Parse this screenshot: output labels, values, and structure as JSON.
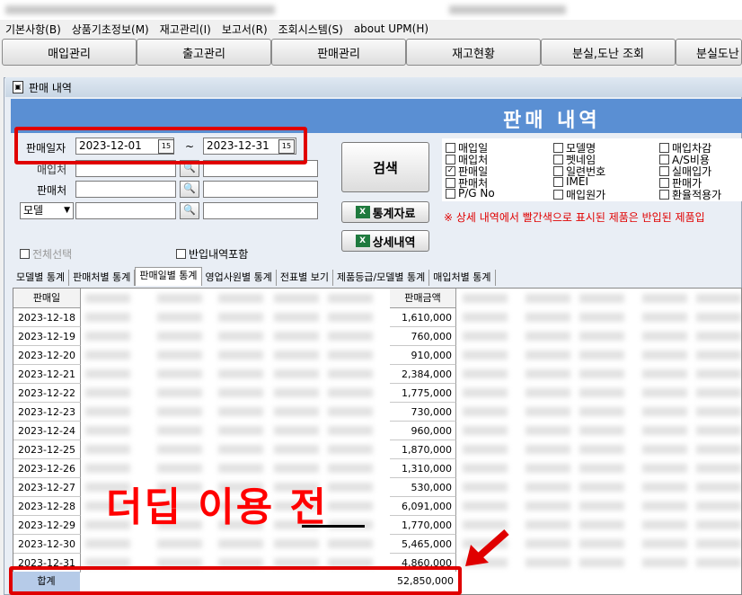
{
  "menubar": [
    "기본사항(B)",
    "상품기초정보(M)",
    "재고관리(I)",
    "보고서(R)",
    "조회시스템(S)",
    "about UPM(H)"
  ],
  "top_tabs": [
    "매입관리",
    "출고관리",
    "판매관리",
    "재고현황",
    "분실,도난 조회",
    "분실도난"
  ],
  "window_title": "판매 내역",
  "header_title": "판매 내역",
  "form": {
    "sale_date_label": "판매일자",
    "date_from": "2023-12-01",
    "date_sep": "~",
    "date_to": "2023-12-31",
    "supplier_label": "매입처",
    "seller_label": "판매처",
    "model_select": "모델",
    "search_button": "검색",
    "stats_button": "통계자료",
    "detail_button": "상세내역",
    "select_all": "전체선택",
    "include_returns": "반입내역포함"
  },
  "checkboxes": [
    [
      {
        "label": "매입일",
        "checked": false
      },
      {
        "label": "매입처",
        "checked": false
      },
      {
        "label": "판매일",
        "checked": true
      },
      {
        "label": "판매처",
        "checked": false
      },
      {
        "label": "P/G No",
        "checked": false
      }
    ],
    [
      {
        "label": "모델명",
        "checked": false
      },
      {
        "label": "펫네임",
        "checked": false
      },
      {
        "label": "일련번호",
        "checked": false
      },
      {
        "label": "IMEI",
        "checked": false
      },
      {
        "label": "매입원가",
        "checked": false
      }
    ],
    [
      {
        "label": "매입차감",
        "checked": false
      },
      {
        "label": "A/S비용",
        "checked": false
      },
      {
        "label": "실매입가",
        "checked": false
      },
      {
        "label": "판매가",
        "checked": false
      },
      {
        "label": "환율적용가",
        "checked": false
      }
    ]
  ],
  "notice": "※ 상세 내역에서 빨간색으로 표시된 제품은 반입된 제품입",
  "sub_tabs": [
    "모델별 통계",
    "판매처별 통계",
    "판매일별 통계",
    "영업사원별 통계",
    "전표별 보기",
    "제품등급/모델별 통계",
    "매입처별 통계"
  ],
  "active_sub_tab": "판매일별 통계",
  "grid": {
    "date_header": "판매일",
    "amount_header": "판매금액",
    "rows": [
      {
        "date": "2023-12-18",
        "amount": "1,610,000"
      },
      {
        "date": "2023-12-19",
        "amount": "760,000"
      },
      {
        "date": "2023-12-20",
        "amount": "910,000"
      },
      {
        "date": "2023-12-21",
        "amount": "2,384,000"
      },
      {
        "date": "2023-12-22",
        "amount": "1,775,000"
      },
      {
        "date": "2023-12-23",
        "amount": "730,000"
      },
      {
        "date": "2023-12-24",
        "amount": "960,000"
      },
      {
        "date": "2023-12-25",
        "amount": "1,870,000"
      },
      {
        "date": "2023-12-26",
        "amount": "1,310,000"
      },
      {
        "date": "2023-12-27",
        "amount": "530,000"
      },
      {
        "date": "2023-12-28",
        "amount": "6,091,000"
      },
      {
        "date": "2023-12-29",
        "amount": "1,770,000"
      },
      {
        "date": "2023-12-30",
        "amount": "5,465,000"
      },
      {
        "date": "2023-12-31",
        "amount": "4,860,000"
      }
    ],
    "total_label": "합계",
    "total_amount": "52,850,000"
  },
  "annotation": "더딥 이용 전",
  "colors": {
    "header_blue": "#5a8fd3",
    "annotation_red": "#ff0000"
  }
}
